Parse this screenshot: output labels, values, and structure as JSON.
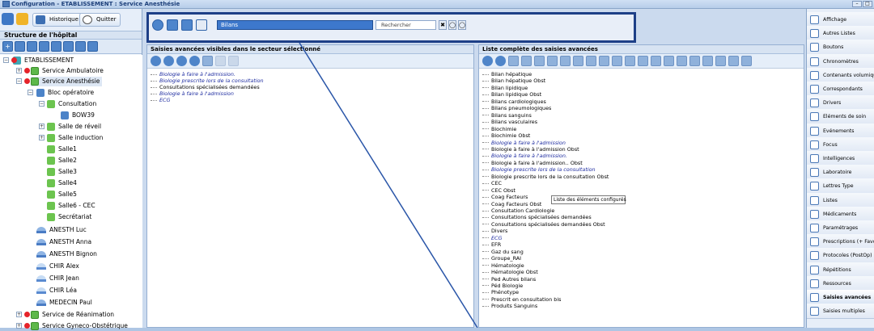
{
  "window": {
    "title": "Configuration - ETABLISSEMENT : Service Anesthésie"
  },
  "left": {
    "historique": "Historique",
    "quitter": "Quitter",
    "section_title": "Structure de l'hôpital",
    "tree": [
      {
        "label": "ETABLISSEMENT",
        "level": 0
      },
      {
        "label": "Service Ambulatoire",
        "level": 1
      },
      {
        "label": "Service Anesthésie",
        "level": 1
      },
      {
        "label": "Bloc opératoire",
        "level": 2
      },
      {
        "label": "Consultation",
        "level": 3
      },
      {
        "label": "BOW39",
        "level": 4
      },
      {
        "label": "Salle de réveil",
        "level": 3
      },
      {
        "label": "Salle induction",
        "level": 3
      },
      {
        "label": "Salle1",
        "level": 3
      },
      {
        "label": "Salle2",
        "level": 3
      },
      {
        "label": "Salle3",
        "level": 3
      },
      {
        "label": "Salle4",
        "level": 3
      },
      {
        "label": "Salle5",
        "level": 3
      },
      {
        "label": "Salle6 - CEC",
        "level": 3
      },
      {
        "label": "Secrétariat",
        "level": 3
      },
      {
        "label": "ANESTH Luc",
        "level": 2
      },
      {
        "label": "ANESTH Anna",
        "level": 2
      },
      {
        "label": "ANESTH Bignon",
        "level": 2
      },
      {
        "label": "CHIR Alex",
        "level": 2
      },
      {
        "label": "CHIR Jean",
        "level": 2
      },
      {
        "label": "CHIR Léa",
        "level": 2
      },
      {
        "label": "MEDECIN Paul",
        "level": 2
      },
      {
        "label": "Service de Réanimation",
        "level": 1
      },
      {
        "label": "Service Gyneco-Obstétrique",
        "level": 1
      }
    ]
  },
  "toolbar": {
    "combo_value": "Bilans",
    "search_placeholder": "Rechercher"
  },
  "panel_left": {
    "title": "Saisies avancées visibles dans le secteur sélectionné",
    "items": [
      {
        "text": "Biologie à faire à l'admission.",
        "italic": true
      },
      {
        "text": "Biologie prescrite lors de la consultation",
        "italic": true
      },
      {
        "text": "Consultations spécialisées demandées",
        "italic": false
      },
      {
        "text": "Biologie à faire à l'admission",
        "italic": true
      },
      {
        "text": "ECG",
        "italic": true
      }
    ]
  },
  "panel_right": {
    "title": "Liste complète des saisies avancées",
    "tooltip": "Liste des éléments configurés",
    "items": [
      {
        "text": "Bilan hépatique",
        "italic": false
      },
      {
        "text": "Bilan hépatique Obst",
        "italic": false
      },
      {
        "text": "Bilan lipidique",
        "italic": false
      },
      {
        "text": "Bilan lipidique Obst",
        "italic": false
      },
      {
        "text": "Bilans cardiologiques",
        "italic": false
      },
      {
        "text": "Bilans pneumologiques",
        "italic": false
      },
      {
        "text": "Bilans sanguins",
        "italic": false
      },
      {
        "text": "Bilans vasculaires",
        "italic": false
      },
      {
        "text": "Biochimie",
        "italic": false
      },
      {
        "text": "Biochimie Obst",
        "italic": false
      },
      {
        "text": "Biologie à faire à l'admission",
        "italic": true
      },
      {
        "text": "Biologie à faire à l'admission Obst",
        "italic": false
      },
      {
        "text": "Biologie à faire à l'admission.",
        "italic": true
      },
      {
        "text": "Biologie à faire à l'admission.. Obst",
        "italic": false
      },
      {
        "text": "Biologie prescrite lors de la consultation",
        "italic": true
      },
      {
        "text": "Biologie prescrite lors de la consultation Obst",
        "italic": false
      },
      {
        "text": "CEC",
        "italic": false
      },
      {
        "text": "CEC Obst",
        "italic": false
      },
      {
        "text": "Coag Facteurs",
        "italic": false
      },
      {
        "text": "Coag Facteurs Obst",
        "italic": false
      },
      {
        "text": "Consultation Cardiologie",
        "italic": false
      },
      {
        "text": "Consultations spécialisées demandées",
        "italic": false
      },
      {
        "text": "Consultations spécialisées demandées Obst",
        "italic": false
      },
      {
        "text": "Divers",
        "italic": false
      },
      {
        "text": "ECG",
        "italic": true
      },
      {
        "text": "EFR",
        "italic": false
      },
      {
        "text": "Gaz du sang",
        "italic": false
      },
      {
        "text": "Groupe_RAI",
        "italic": false
      },
      {
        "text": "Hématologie",
        "italic": false
      },
      {
        "text": "Hématologie Obst",
        "italic": false
      },
      {
        "text": "Ped Autres bilans",
        "italic": false
      },
      {
        "text": "Péd Biologie",
        "italic": false
      },
      {
        "text": "Phénotype",
        "italic": false
      },
      {
        "text": "Prescrit en consultation bis",
        "italic": false
      },
      {
        "text": "Produits Sanguins",
        "italic": false
      }
    ]
  },
  "right_nav": [
    {
      "label": "Affichage"
    },
    {
      "label": "Autres Listes"
    },
    {
      "label": "Boutons"
    },
    {
      "label": "Chronomètres"
    },
    {
      "label": "Contenants volumiques"
    },
    {
      "label": "Correspondants"
    },
    {
      "label": "Drivers"
    },
    {
      "label": "Eléments de soin"
    },
    {
      "label": "Evénements"
    },
    {
      "label": "Focus"
    },
    {
      "label": "Intelligences"
    },
    {
      "label": "Laboratoire"
    },
    {
      "label": "Lettres Type"
    },
    {
      "label": "Listes"
    },
    {
      "label": "Médicaments"
    },
    {
      "label": "Paramétrages"
    },
    {
      "label": "Prescriptions (+ Favoris)"
    },
    {
      "label": "Protocoles (PostOp)"
    },
    {
      "label": "Répétitions"
    },
    {
      "label": "Ressources"
    },
    {
      "label": "Saisies avancées",
      "selected": true
    },
    {
      "label": "Saisies multiples"
    }
  ]
}
